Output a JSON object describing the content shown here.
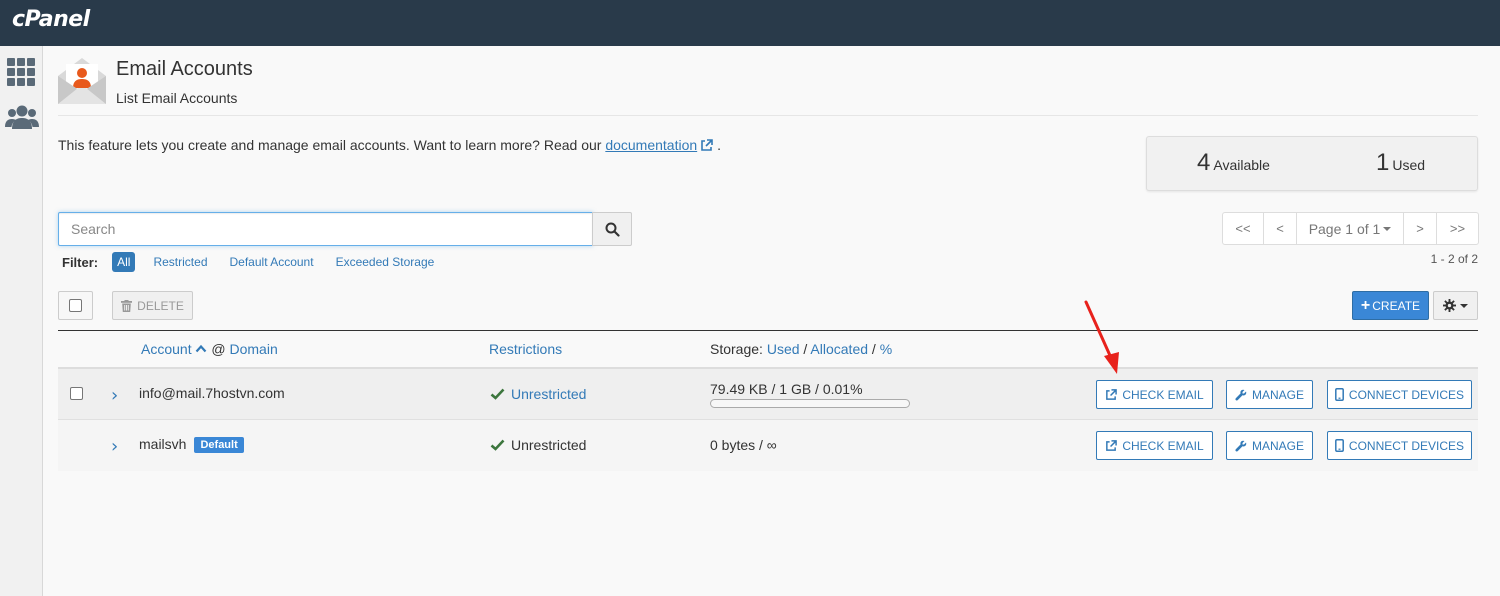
{
  "app": {
    "logo": "cPanel"
  },
  "sidebar": {
    "items": [
      {
        "icon": "grid-icon",
        "label": ""
      },
      {
        "icon": "users-icon",
        "label": ""
      }
    ]
  },
  "header": {
    "title": "Email Accounts",
    "subtitle": "List Email Accounts"
  },
  "intro": {
    "text": "This feature lets you create and manage email accounts. Want to learn more? Read our ",
    "link": "documentation",
    "suffix": "."
  },
  "stats": {
    "available_num": "4",
    "available_label": "Available",
    "used_num": "1",
    "used_label": "Used"
  },
  "search": {
    "placeholder": "Search",
    "value": ""
  },
  "filter": {
    "label": "Filter:",
    "options": [
      "All",
      "Restricted",
      "Default Account",
      "Exceeded Storage"
    ],
    "active": "All"
  },
  "pagination": {
    "first": "<<",
    "prev": "<",
    "page": "Page 1 of 1",
    "next": ">",
    "last": ">>",
    "range": "1 - 2 of 2"
  },
  "toolbar": {
    "delete_label": "DELETE",
    "create_label": "CREATE"
  },
  "table": {
    "headers": {
      "account": "Account",
      "at": "@",
      "domain": "Domain",
      "restrictions": "Restrictions",
      "storage": "Storage:",
      "used": "Used",
      "slash": "/",
      "allocated": "Allocated",
      "percent": "%"
    },
    "rows": [
      {
        "account": "info@mail.7hostvn.com",
        "badge": "",
        "restriction": "Unrestricted",
        "storage": "79.49 KB / 1 GB / 0.01%",
        "usage_fraction": 0.0001,
        "actions": {
          "check": "CHECK EMAIL",
          "manage": "MANAGE",
          "connect": "CONNECT DEVICES"
        }
      },
      {
        "account": "mailsvh",
        "badge": "Default",
        "restriction": "Unrestricted",
        "storage": "0 bytes / ∞",
        "actions": {
          "check": "CHECK EMAIL",
          "manage": "MANAGE",
          "connect": "CONNECT DEVICES"
        }
      }
    ]
  },
  "colors": {
    "topbar": "#293a4a",
    "accent": "#337ab7",
    "primary_button": "#3a87d6",
    "check": "#3c763d",
    "annotation_arrow": "#e8221c"
  }
}
